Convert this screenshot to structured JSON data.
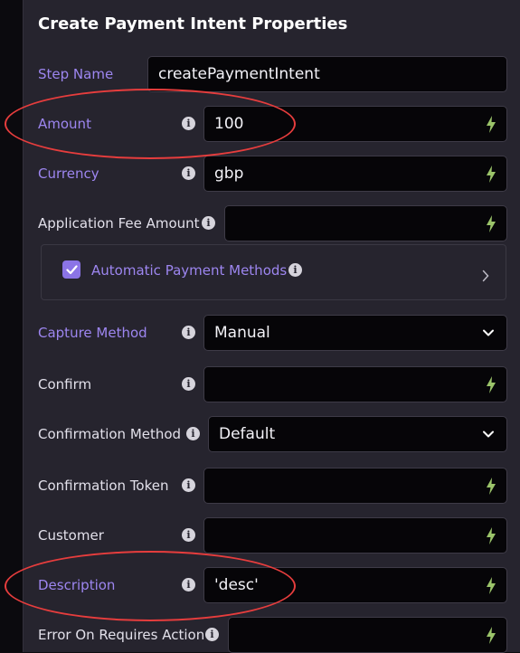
{
  "panel": {
    "title": "Create Payment Intent Properties"
  },
  "fields": {
    "step_name": {
      "label": "Step Name",
      "value": "createPaymentIntent"
    },
    "amount": {
      "label": "Amount",
      "value": "100",
      "icon": "bolt-icon"
    },
    "currency": {
      "label": "Currency",
      "value": "gbp",
      "icon": "bolt-icon"
    },
    "application_fee_amount": {
      "label": "Application Fee Amount",
      "value": "",
      "icon": "bolt-icon"
    },
    "automatic_payment_methods": {
      "label": "Automatic Payment Methods",
      "checked": true
    },
    "capture_method": {
      "label": "Capture Method",
      "value": "Manual",
      "icon": "chevron-down-icon"
    },
    "confirm": {
      "label": "Confirm",
      "value": "",
      "icon": "bolt-icon"
    },
    "confirmation_method": {
      "label": "Confirmation Method",
      "value": "Default",
      "icon": "chevron-down-icon"
    },
    "confirmation_token": {
      "label": "Confirmation Token",
      "value": "",
      "icon": "bolt-icon"
    },
    "customer": {
      "label": "Customer",
      "value": "",
      "icon": "bolt-icon"
    },
    "description": {
      "label": "Description",
      "value": "'desc'",
      "icon": "bolt-icon"
    },
    "error_on_requires_action": {
      "label": "Error On Requires Action",
      "value": "",
      "icon": "bolt-icon"
    }
  },
  "info_icon_glyph": "i",
  "colors": {
    "panel_bg": "#26242e",
    "field_bg": "#060508",
    "accent_label": "#9d86f0",
    "checkbox": "#8b74e6",
    "bolt": "#9bc46a",
    "annotation_red": "#e63d3d"
  }
}
